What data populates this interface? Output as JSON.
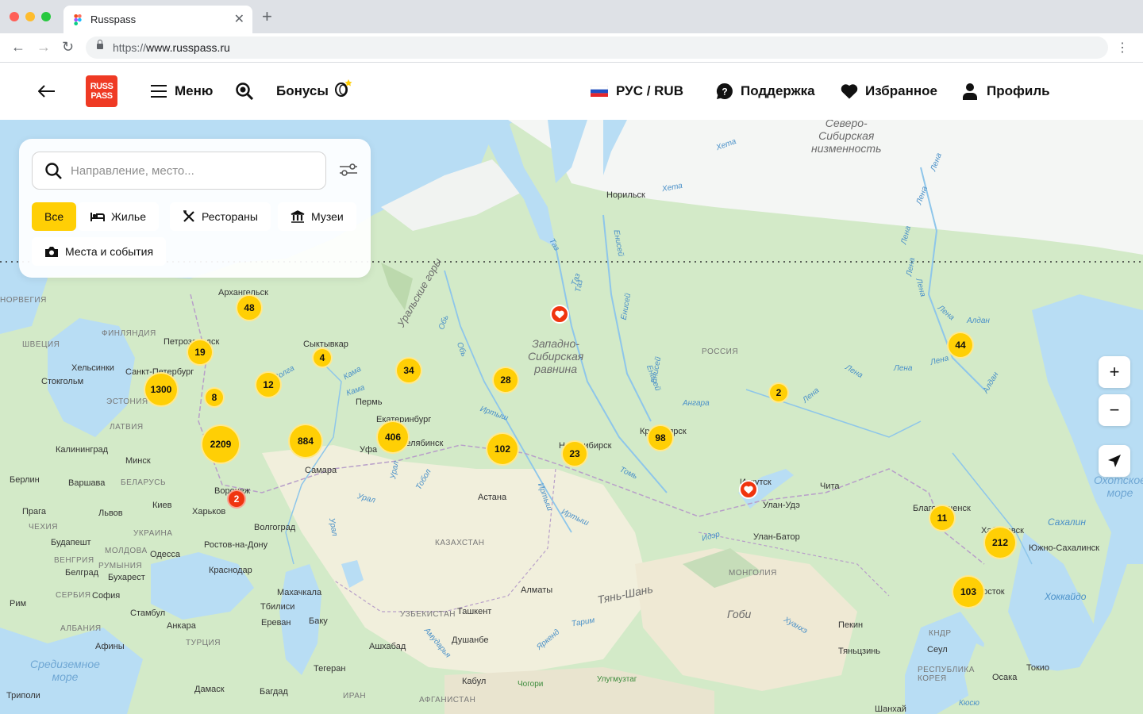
{
  "browser": {
    "tab_title": "Russpass",
    "url_protocol": "https://",
    "url_host": "www.russpass.ru"
  },
  "header": {
    "logo_line1": "RUSS",
    "logo_line2": "PASS",
    "menu_label": "Меню",
    "bonus_label": "Бонусы",
    "locale_label": "РУС / RUB",
    "support_label": "Поддержка",
    "favorites_label": "Избранное",
    "profile_label": "Профиль"
  },
  "search": {
    "placeholder": "Направление, место..."
  },
  "filters": [
    {
      "label": "Все",
      "icon": "all",
      "active": true
    },
    {
      "label": "Жилье",
      "icon": "bed-icon",
      "active": false
    },
    {
      "label": "Рестораны",
      "icon": "cutlery-icon",
      "active": false
    },
    {
      "label": "Музеи",
      "icon": "museum-icon",
      "active": false
    },
    {
      "label": "Места и события",
      "icon": "camera-icon",
      "active": false
    }
  ],
  "map_labels": {
    "cities": [
      "Архангельск",
      "Петрозаводск",
      "Сыктывкар",
      "Санкт-Петербург",
      "Хельсинки",
      "Стокгольм",
      "Пермь",
      "Екатеринбург",
      "Челябинск",
      "Уфа",
      "Самара",
      "Калининград",
      "Минск",
      "Берлин",
      "Варшава",
      "Киев",
      "Харьков",
      "Воронеж",
      "Прага",
      "Львов",
      "Будапешт",
      "Волгоград",
      "Ростов-на-Дону",
      "Одесса",
      "Бухарест",
      "Белград",
      "Краснодар",
      "София",
      "Рим",
      "Махачкала",
      "Стамбул",
      "Анкара",
      "Тбилиси",
      "Ереван",
      "Баку",
      "Афины",
      "Тегеран",
      "Ашхабад",
      "Ташкент",
      "Душанбе",
      "Алматы",
      "Кабул",
      "Астана",
      "Новосибирск",
      "Красноярск",
      "Иркутск",
      "Улан-Удэ",
      "Чита",
      "Улан-Батор",
      "Благовещенск",
      "Хабаровск",
      "Владивосток",
      "Южно-Сахалинск",
      "Норильск",
      "Пекин",
      "Тяньцзинь",
      "Сеул",
      "Осака",
      "Токио",
      "Шанхай",
      "Дамаск",
      "Багдад",
      "Триполи"
    ],
    "countries": [
      "НОРВЕГИЯ",
      "ФИНЛЯНДИЯ",
      "ШВЕЦИЯ",
      "ЭСТОНИЯ",
      "ЛАТВИЯ",
      "БЕЛАРУСЬ",
      "УКРАИНА",
      "МОЛДОВА",
      "РУМЫНИЯ",
      "ВЕНГРИЯ",
      "ЧЕХИЯ",
      "СЕРБИЯ",
      "АЛБАНИЯ",
      "ТУРЦИЯ",
      "УЗБЕКИСТАН",
      "КАЗАХСТАН",
      "МОНГОЛИЯ",
      "РОССИЯ",
      "ИРАН",
      "АФГАНИСТАН",
      "КНДР",
      "РЕСПУБЛИКА КОРЕЯ"
    ],
    "regions": [
      "Западно-Сибирская равнина",
      "Северо-Сибирская низменность",
      "Уральские горы",
      "Гоби",
      "Тянь-Шань",
      "Средиземное море",
      "Охотское море",
      "Сахалин",
      "Хоккайдо",
      "Кюсю",
      "Чогори",
      "Улугмузтаг"
    ],
    "water": [
      "Обь",
      "Иртыш",
      "Енисей",
      "Лена",
      "Алдан",
      "Ангара",
      "Томь",
      "Тобол",
      "Урал",
      "Кама",
      "Волга",
      "Таз",
      "Хета",
      "Амударья",
      "Тарим",
      "Хуанхэ",
      "Идэр"
    ]
  },
  "clusters": [
    {
      "count": "48",
      "color": "yellow"
    },
    {
      "count": "19",
      "color": "yellow"
    },
    {
      "count": "4",
      "color": "yellow"
    },
    {
      "count": "1300",
      "color": "yellow"
    },
    {
      "count": "8",
      "color": "yellow"
    },
    {
      "count": "12",
      "color": "yellow"
    },
    {
      "count": "34",
      "color": "yellow"
    },
    {
      "count": "28",
      "color": "yellow"
    },
    {
      "count": "2209",
      "color": "yellow"
    },
    {
      "count": "884",
      "color": "yellow"
    },
    {
      "count": "406",
      "color": "yellow"
    },
    {
      "count": "102",
      "color": "yellow"
    },
    {
      "count": "23",
      "color": "yellow"
    },
    {
      "count": "98",
      "color": "yellow"
    },
    {
      "count": "2",
      "color": "yellow"
    },
    {
      "count": "44",
      "color": "yellow"
    },
    {
      "count": "11",
      "color": "yellow"
    },
    {
      "count": "212",
      "color": "yellow"
    },
    {
      "count": "103",
      "color": "yellow"
    },
    {
      "count": "2",
      "color": "red"
    }
  ],
  "colors": {
    "brand": "#ef3a24",
    "accent": "#ffcf05",
    "water": "#b8ddf4",
    "land": "#cde8c4"
  },
  "map_controls": {
    "zoom_in": "+",
    "zoom_out": "−"
  }
}
